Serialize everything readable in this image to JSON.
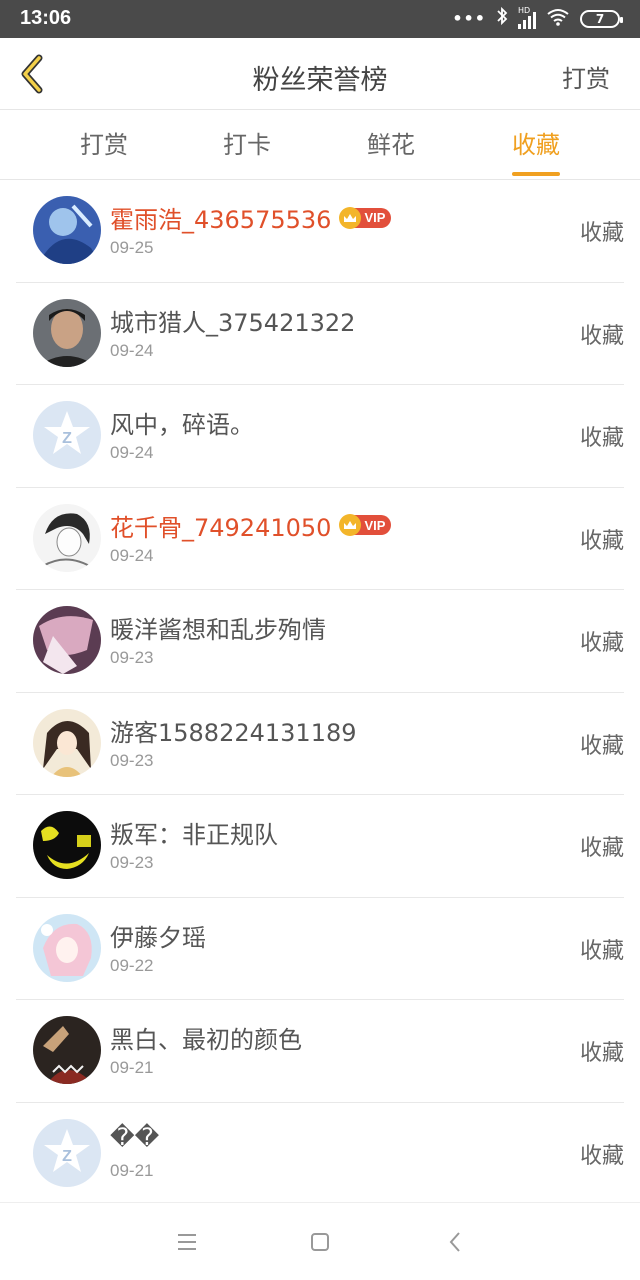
{
  "status_bar": {
    "time": "13:06",
    "signal_label": "HD",
    "battery_level": "7"
  },
  "header": {
    "title": "粉丝荣誉榜",
    "action_label": "打赏",
    "back_icon": "chevron-left-icon"
  },
  "tabs": [
    {
      "label": "打赏",
      "active": false
    },
    {
      "label": "打卡",
      "active": false
    },
    {
      "label": "鲜花",
      "active": false
    },
    {
      "label": "收藏",
      "active": true
    }
  ],
  "colors": {
    "accent": "#f0a020",
    "vip_name": "#e0502a",
    "vip_badge": "#e24f3b",
    "crown": "#f3b52a"
  },
  "vip_label": "VIP",
  "fans": [
    {
      "name": "霍雨浩_436575536",
      "date": "09-25",
      "action": "收藏",
      "vip": true,
      "avatar": "anime-blue-avatar"
    },
    {
      "name": "城市猎人_375421322",
      "date": "09-24",
      "action": "收藏",
      "vip": false,
      "avatar": "photo-avatar"
    },
    {
      "name": "风中，碎语。",
      "date": "09-24",
      "action": "收藏",
      "vip": false,
      "avatar": "default-avatar"
    },
    {
      "name": "花千骨_749241050",
      "date": "09-24",
      "action": "收藏",
      "vip": true,
      "avatar": "sketch-avatar"
    },
    {
      "name": "暖洋酱想和乱步殉情",
      "date": "09-23",
      "action": "收藏",
      "vip": false,
      "avatar": "anime-pink-avatar"
    },
    {
      "name": "游客1588224131189",
      "date": "09-23",
      "action": "收藏",
      "vip": false,
      "avatar": "anime-girl-avatar"
    },
    {
      "name": "叛军：非正规队",
      "date": "09-23",
      "action": "收藏",
      "vip": false,
      "avatar": "yellow-dark-avatar"
    },
    {
      "name": "伊藤夕瑶",
      "date": "09-22",
      "action": "收藏",
      "vip": false,
      "avatar": "anime-light-avatar"
    },
    {
      "name": "黑白、最初的颜色",
      "date": "09-21",
      "action": "收藏",
      "vip": false,
      "avatar": "dark-photo-avatar"
    },
    {
      "name": "��",
      "date": "09-21",
      "action": "收藏",
      "vip": false,
      "avatar": "default-avatar"
    }
  ],
  "nav_bar": [
    "menu-icon",
    "home-square-icon",
    "back-triangle-icon"
  ]
}
